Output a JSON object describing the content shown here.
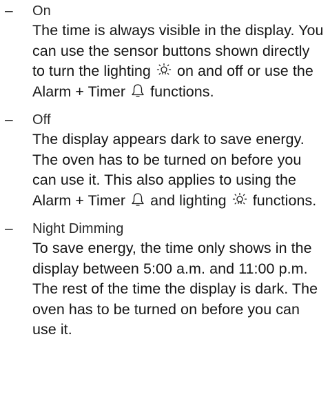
{
  "dash": "–",
  "items": [
    {
      "title": "On",
      "segments": [
        "The time is always visible in the display. You can use the sensor buttons shown directly to turn the lighting",
        "on and off or use the Alarm + Timer",
        "functions."
      ]
    },
    {
      "title": "Off",
      "segments": [
        "The display appears dark to save energy. The oven has to be turned on before you can use it. This also applies to using the Alarm + Timer",
        "and lighting",
        "functions."
      ]
    },
    {
      "title": "Night Dimming",
      "segments": [
        "To save energy, the time only shows in the display between 5:00 a.m. and 11:00 p.m. The rest of the time the display is dark. The oven has to be turned on before you can use it."
      ]
    }
  ],
  "icons": {
    "lighting": "lighting-icon",
    "alarm": "bell-icon"
  }
}
